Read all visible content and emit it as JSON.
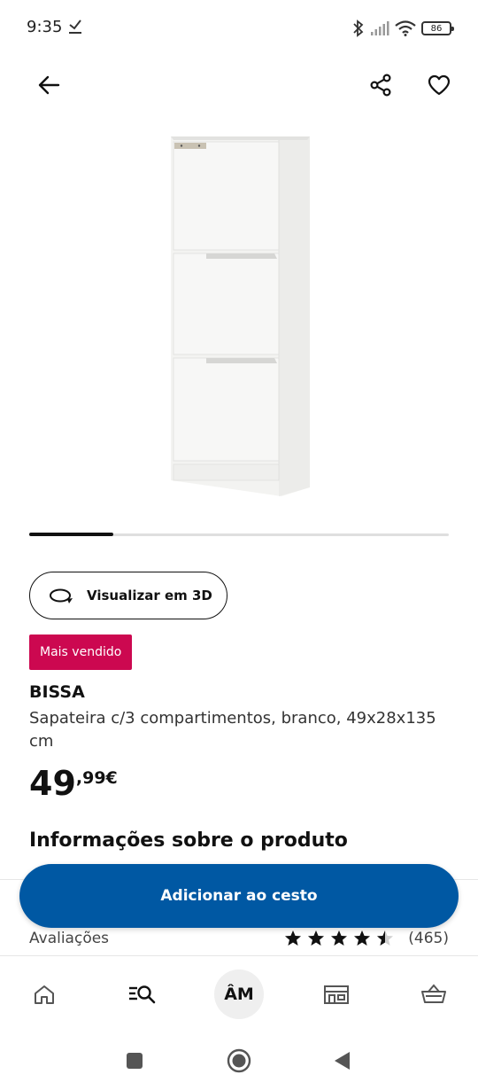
{
  "status_bar": {
    "time": "9:35",
    "battery": "86",
    "icons": [
      "download-done-icon",
      "bluetooth-icon",
      "signal-icon",
      "wifi-icon",
      "battery-icon"
    ]
  },
  "top_nav": {
    "back_icon": "arrow-left-icon",
    "share_icon": "share-icon",
    "favorite_icon": "heart-icon"
  },
  "carousel": {
    "current_fraction": 0.2
  },
  "view_3d": {
    "label": "Visualizar em 3D",
    "icon": "rotate-3d-icon"
  },
  "product": {
    "badge": "Mais vendido",
    "name": "BISSA",
    "description": "Sapateira c/3 compartimentos, branco, 49x28x135 cm",
    "price_integer": "49",
    "price_decimal": ",99€"
  },
  "info_section": {
    "title": "Informações sobre o produto"
  },
  "reviews": {
    "label": "Avaliações",
    "rating": 4.5,
    "count": "(465)"
  },
  "cta": {
    "add_to_cart": "Adicionar ao cesto"
  },
  "bottom_nav": {
    "items": [
      {
        "icon": "home-icon"
      },
      {
        "icon": "search-list-icon"
      },
      {
        "label": "ÂM"
      },
      {
        "icon": "store-icon"
      },
      {
        "icon": "basket-icon"
      }
    ]
  },
  "colors": {
    "accent": "#0058a3",
    "badge": "#cc0850"
  }
}
